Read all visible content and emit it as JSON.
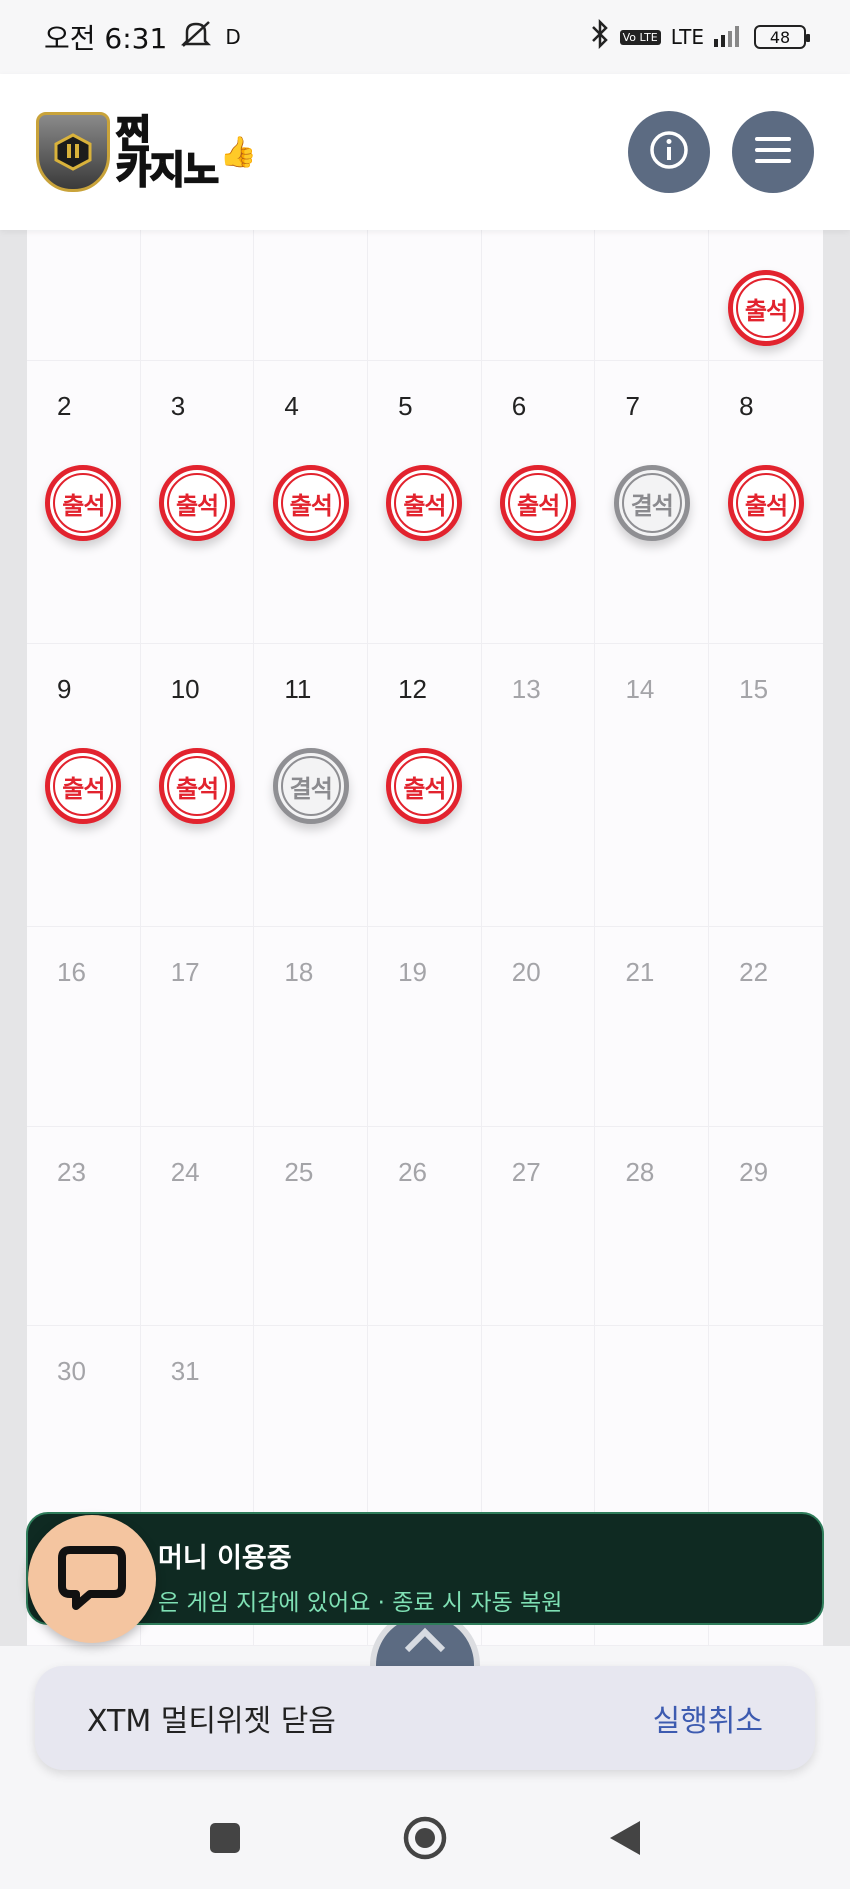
{
  "status_bar": {
    "time": "오전 6:31",
    "indicator": "D",
    "network": "LTE",
    "volte": "Vo LTE",
    "battery": "48"
  },
  "header": {
    "logo_text_line1": "찐",
    "logo_text_line2": "카지노"
  },
  "calendar": {
    "weeks": [
      [
        {
          "day": "",
          "stamp": ""
        },
        {
          "day": "",
          "stamp": ""
        },
        {
          "day": "",
          "stamp": ""
        },
        {
          "day": "",
          "stamp": ""
        },
        {
          "day": "",
          "stamp": ""
        },
        {
          "day": "",
          "stamp": ""
        },
        {
          "day": "",
          "stamp": "출석",
          "status": "present"
        }
      ],
      [
        {
          "day": "2",
          "stamp": "출석",
          "status": "present"
        },
        {
          "day": "3",
          "stamp": "출석",
          "status": "present"
        },
        {
          "day": "4",
          "stamp": "출석",
          "status": "present"
        },
        {
          "day": "5",
          "stamp": "출석",
          "status": "present"
        },
        {
          "day": "6",
          "stamp": "출석",
          "status": "present"
        },
        {
          "day": "7",
          "stamp": "결석",
          "status": "absent"
        },
        {
          "day": "8",
          "stamp": "출석",
          "status": "present"
        }
      ],
      [
        {
          "day": "9",
          "stamp": "출석",
          "status": "present"
        },
        {
          "day": "10",
          "stamp": "출석",
          "status": "present"
        },
        {
          "day": "11",
          "stamp": "결석",
          "status": "absent"
        },
        {
          "day": "12",
          "stamp": "출석",
          "status": "present"
        },
        {
          "day": "13",
          "stamp": "",
          "future": true
        },
        {
          "day": "14",
          "stamp": "",
          "future": true
        },
        {
          "day": "15",
          "stamp": "",
          "future": true
        }
      ],
      [
        {
          "day": "16",
          "future": true
        },
        {
          "day": "17",
          "future": true
        },
        {
          "day": "18",
          "future": true
        },
        {
          "day": "19",
          "future": true
        },
        {
          "day": "20",
          "future": true
        },
        {
          "day": "21",
          "future": true
        },
        {
          "day": "22",
          "future": true
        }
      ],
      [
        {
          "day": "23",
          "future": true
        },
        {
          "day": "24",
          "future": true
        },
        {
          "day": "25",
          "future": true
        },
        {
          "day": "26",
          "future": true
        },
        {
          "day": "27",
          "future": true
        },
        {
          "day": "28",
          "future": true
        },
        {
          "day": "29",
          "future": true
        }
      ],
      [
        {
          "day": "30",
          "future": true
        },
        {
          "day": "31",
          "future": true
        },
        {
          "day": "",
          "future": true
        },
        {
          "day": "",
          "future": true
        },
        {
          "day": "",
          "future": true
        },
        {
          "day": "",
          "future": true
        },
        {
          "day": "",
          "future": true
        }
      ]
    ]
  },
  "money_banner": {
    "title": "머니 이용중",
    "subtitle": "은 게임 지갑에 있어요 · 종료 시 자동 복원"
  },
  "toast": {
    "message": "XTM 멀티위젯 닫음",
    "action": "실행취소"
  },
  "icons": {
    "info": "info-icon",
    "menu": "hamburger-menu-icon",
    "chat": "chat-bubble-icon",
    "scroll_top": "chevron-up-icon"
  }
}
